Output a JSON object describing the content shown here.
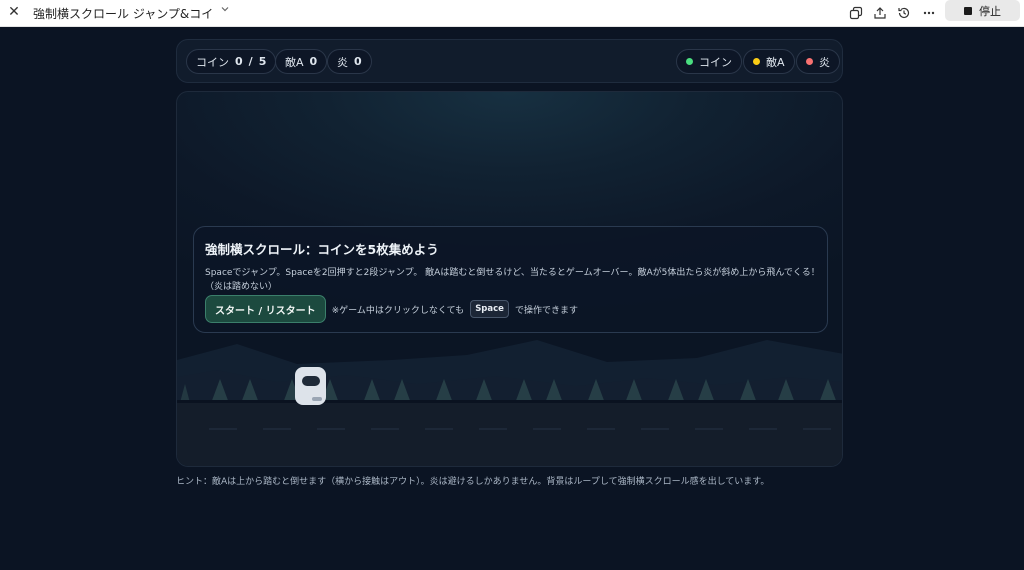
{
  "window": {
    "title": "強制横スクロール ジャンプ&コインゲ...",
    "stop_label": "停止"
  },
  "hud": {
    "coin_label": "コイン",
    "coin_count": "0",
    "coin_sep": "/",
    "coin_total": "5",
    "enemy_label": "敵A",
    "enemy_count": "0",
    "flame_label": "炎",
    "flame_count": "0",
    "legend": [
      {
        "label": "コイン",
        "color": "#4ade80"
      },
      {
        "label": "敵A",
        "color": "#facc15"
      },
      {
        "label": "炎",
        "color": "#f87171"
      }
    ]
  },
  "panel": {
    "title": "強制横スクロール：コインを5枚集めよう",
    "description": "Spaceでジャンプ。Spaceを2回押すと2段ジャンプ。 敵Aは踏むと倒せるけど、当たるとゲームオーバー。敵Aが5体出たら炎が斜め上から飛んでくる！（炎は踏めない）",
    "start_button": "スタート / リスタート",
    "note_before": "※ゲーム中はクリックしなくても",
    "key_label": "Space",
    "note_after": "で操作できます"
  },
  "hint": "ヒント：敵Aは上から踏むと倒せます（横から接触はアウト）。炎は避けるしかありません。背景はループして強制横スクロール感を出しています。",
  "colors": {
    "background": "#0b1423",
    "accent_button": "#1c4a3f",
    "coin": "#4ade80",
    "enemy": "#facc15",
    "flame": "#f87171"
  },
  "icons": [
    "close-icon",
    "chevron-down-icon",
    "copy-icon",
    "share-icon",
    "history-icon",
    "more-icon",
    "stop-icon"
  ]
}
